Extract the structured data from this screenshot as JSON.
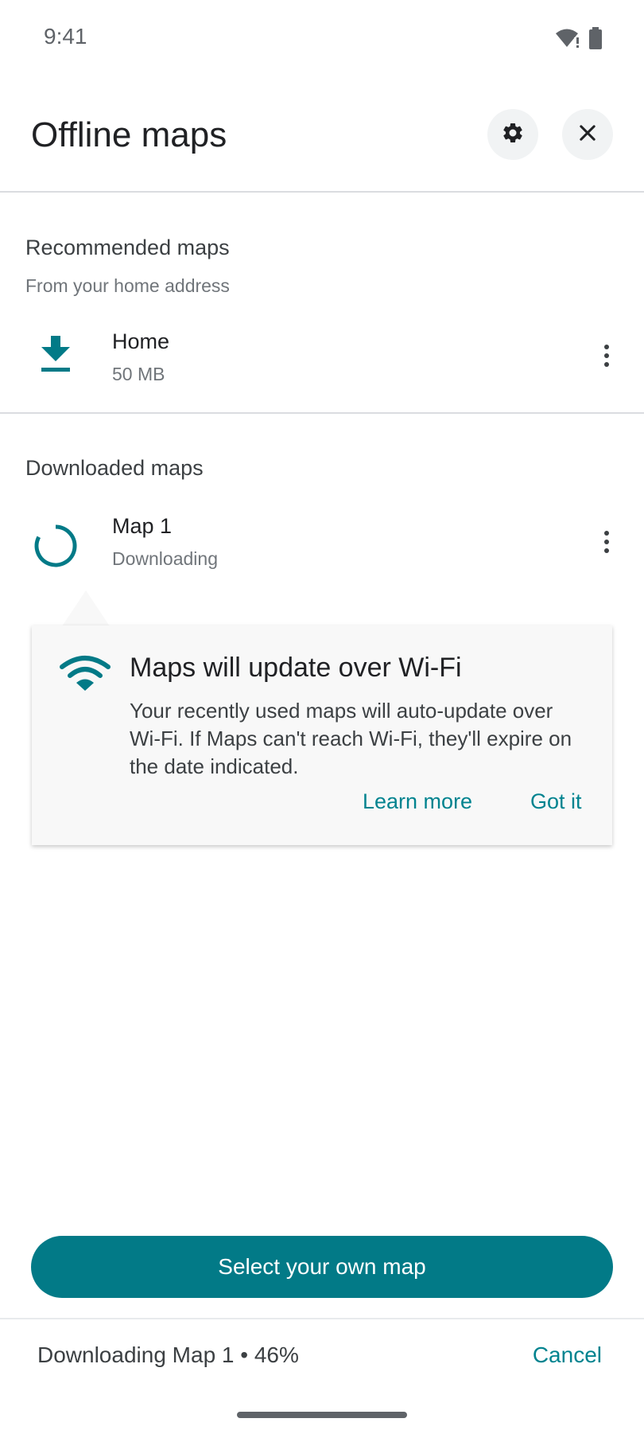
{
  "status_bar": {
    "time": "9:41",
    "icons": [
      "wifi-icon",
      "battery-icon"
    ]
  },
  "header": {
    "title": "Offline maps",
    "settings_icon": "gear-icon",
    "close_icon": "close-icon"
  },
  "recommended": {
    "title": "Recommended maps",
    "subtitle": "From your home address",
    "item": {
      "name": "Home",
      "size": "50 MB",
      "icon": "download-icon"
    }
  },
  "downloaded": {
    "title": "Downloaded maps",
    "item": {
      "name": "Map 1",
      "status": "Downloading",
      "icon": "progress-spinner-icon"
    }
  },
  "tooltip": {
    "icon": "wifi-icon",
    "title": "Maps will update over Wi-Fi",
    "body": "Your recently used maps will auto-update over Wi-Fi. If Maps can't reach Wi-Fi, they'll expire on the date indicated.",
    "learn_more": "Learn more",
    "got_it": "Got it"
  },
  "primary_button": {
    "label": "Select your own map"
  },
  "bottom_bar": {
    "status": "Downloading Map 1 • 46%",
    "progress_percent": 46,
    "cancel": "Cancel"
  },
  "colors": {
    "accent": "#027a87",
    "link": "#00838f",
    "divider": "#dadce0"
  }
}
